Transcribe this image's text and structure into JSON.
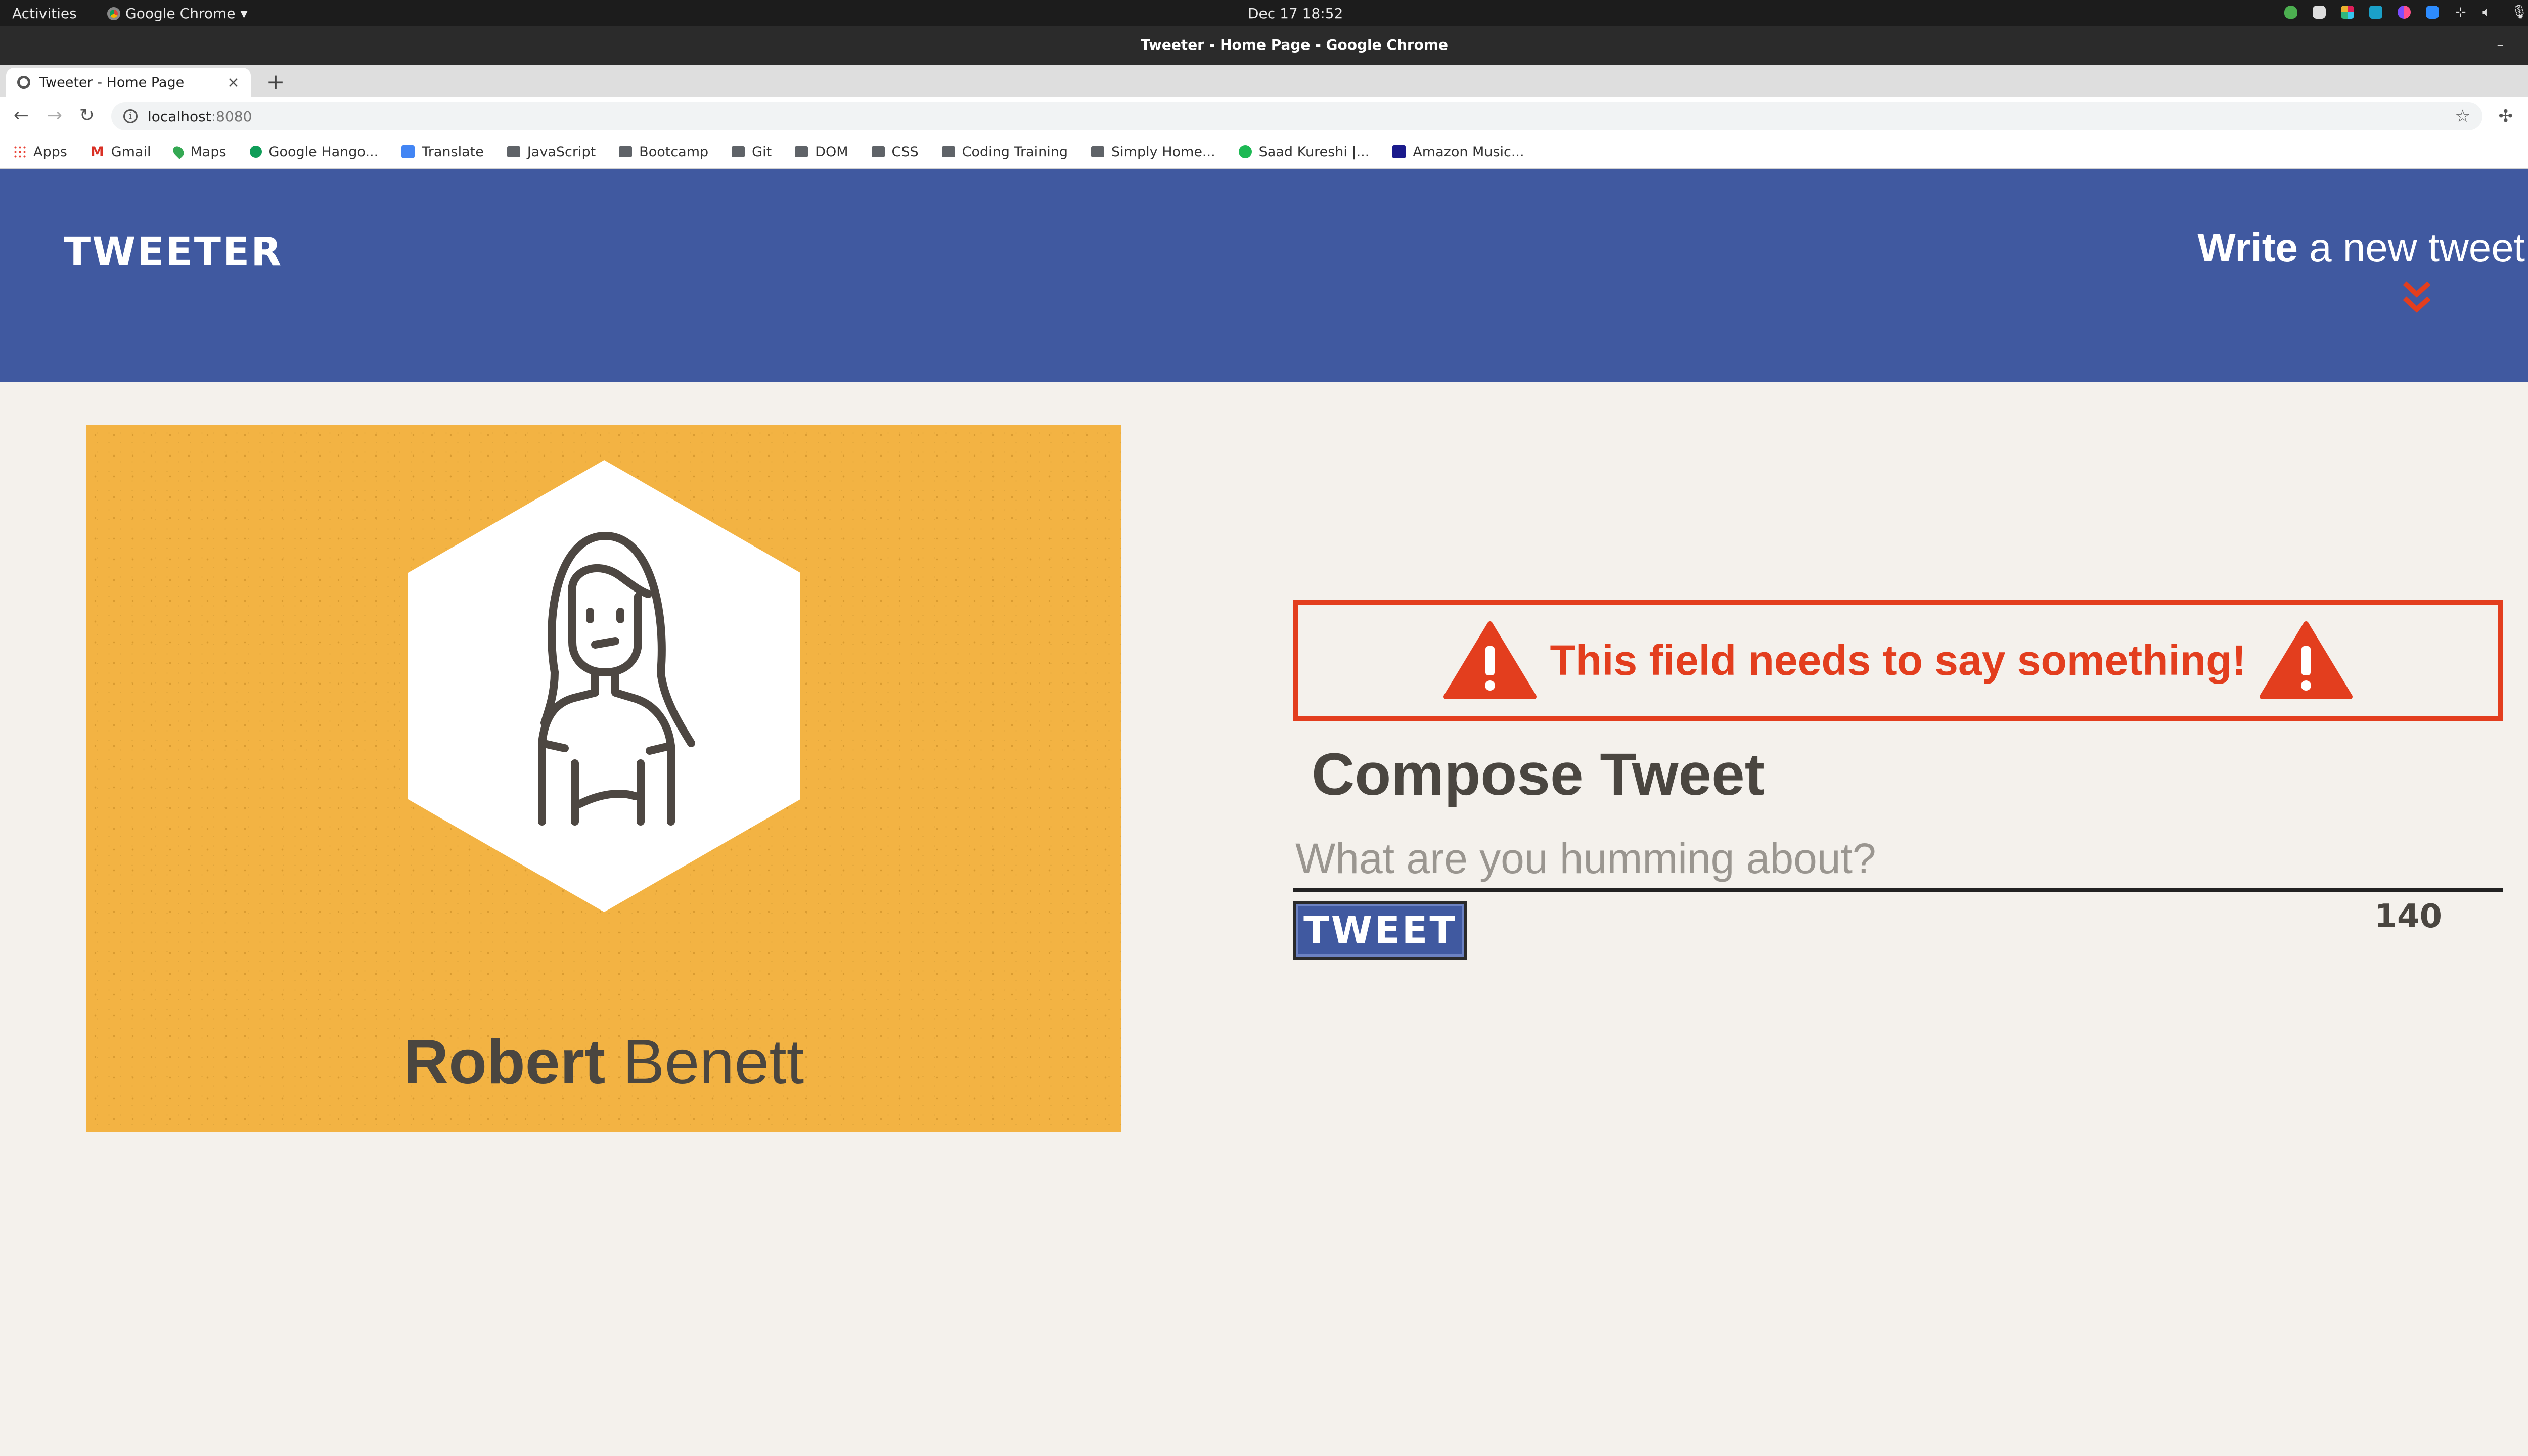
{
  "os": {
    "activities": "Activities",
    "app_menu": "Google Chrome",
    "clock": "Dec 17  18:52"
  },
  "browser": {
    "window_title": "Tweeter - Home Page - Google Chrome",
    "tab_title": "Tweeter - Home Page",
    "url_host": "localhost",
    "url_port": ":8080",
    "bookmarks": [
      {
        "label": "Apps",
        "icon": "apps-grid-icon"
      },
      {
        "label": "Gmail",
        "icon": "gmail-icon"
      },
      {
        "label": "Maps",
        "icon": "maps-pin-icon"
      },
      {
        "label": "Google Hango...",
        "icon": "hangouts-icon"
      },
      {
        "label": "Translate",
        "icon": "translate-icon"
      },
      {
        "label": "JavaScript",
        "icon": "folder-icon"
      },
      {
        "label": "Bootcamp",
        "icon": "folder-icon"
      },
      {
        "label": "Git",
        "icon": "folder-icon"
      },
      {
        "label": "DOM",
        "icon": "folder-icon"
      },
      {
        "label": "CSS",
        "icon": "folder-icon"
      },
      {
        "label": "Coding Training",
        "icon": "folder-icon"
      },
      {
        "label": "Simply Home...",
        "icon": "folder-icon"
      },
      {
        "label": "Saad Kureshi |...",
        "icon": "spotify-icon"
      },
      {
        "label": "Amazon Music...",
        "icon": "amazon-music-icon"
      }
    ]
  },
  "header": {
    "brand": "TWEETER",
    "write_bold": "Write",
    "write_rest": " a new tweet",
    "accent_color": "#e33e1e",
    "background_color": "#4059a0"
  },
  "profile": {
    "first_name": "Robert",
    "last_name": " Benett",
    "avatar_icon": "user-avatar-icon",
    "card_color": "#f3b343"
  },
  "compose": {
    "error_message": "This field needs to say something!",
    "title": "Compose Tweet",
    "placeholder": "What are you humming about?",
    "value": "",
    "button_label": "TWEET",
    "char_count": "140"
  }
}
